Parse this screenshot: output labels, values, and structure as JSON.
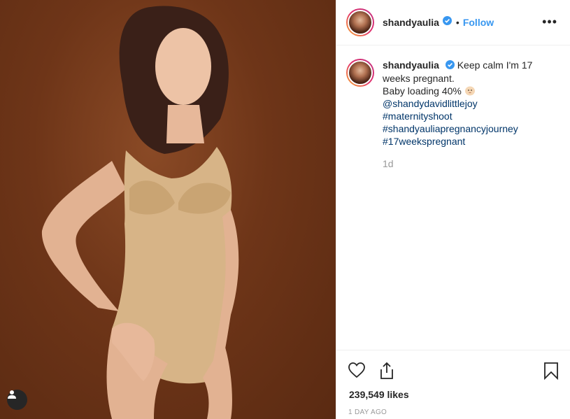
{
  "post": {
    "username": "shandyaulia",
    "follow_label": "Follow",
    "separator": "•",
    "more_label": "•••",
    "caption_line1": "Keep calm I'm 17 weeks pregnant.",
    "caption_line2": "Baby loading 40%",
    "mention": "@shandydavidlittlejoy",
    "hashtags": [
      "#maternityshoot",
      "#shandyauliapregnancyjourney",
      "#17weekspregnant"
    ],
    "relative_time": "1d",
    "likes": "239,549 likes",
    "posted_ago": "1 DAY AGO"
  },
  "icons": {
    "verified": "verified-badge-icon",
    "user_tag": "user-tag-icon",
    "like": "heart-icon",
    "share": "share-icon",
    "save": "bookmark-icon",
    "emoji": "baby-emoji-icon"
  },
  "colors": {
    "follow": "#3897f0",
    "hashtag": "#003569",
    "muted": "#999999",
    "photo_background": "#6e3518"
  }
}
